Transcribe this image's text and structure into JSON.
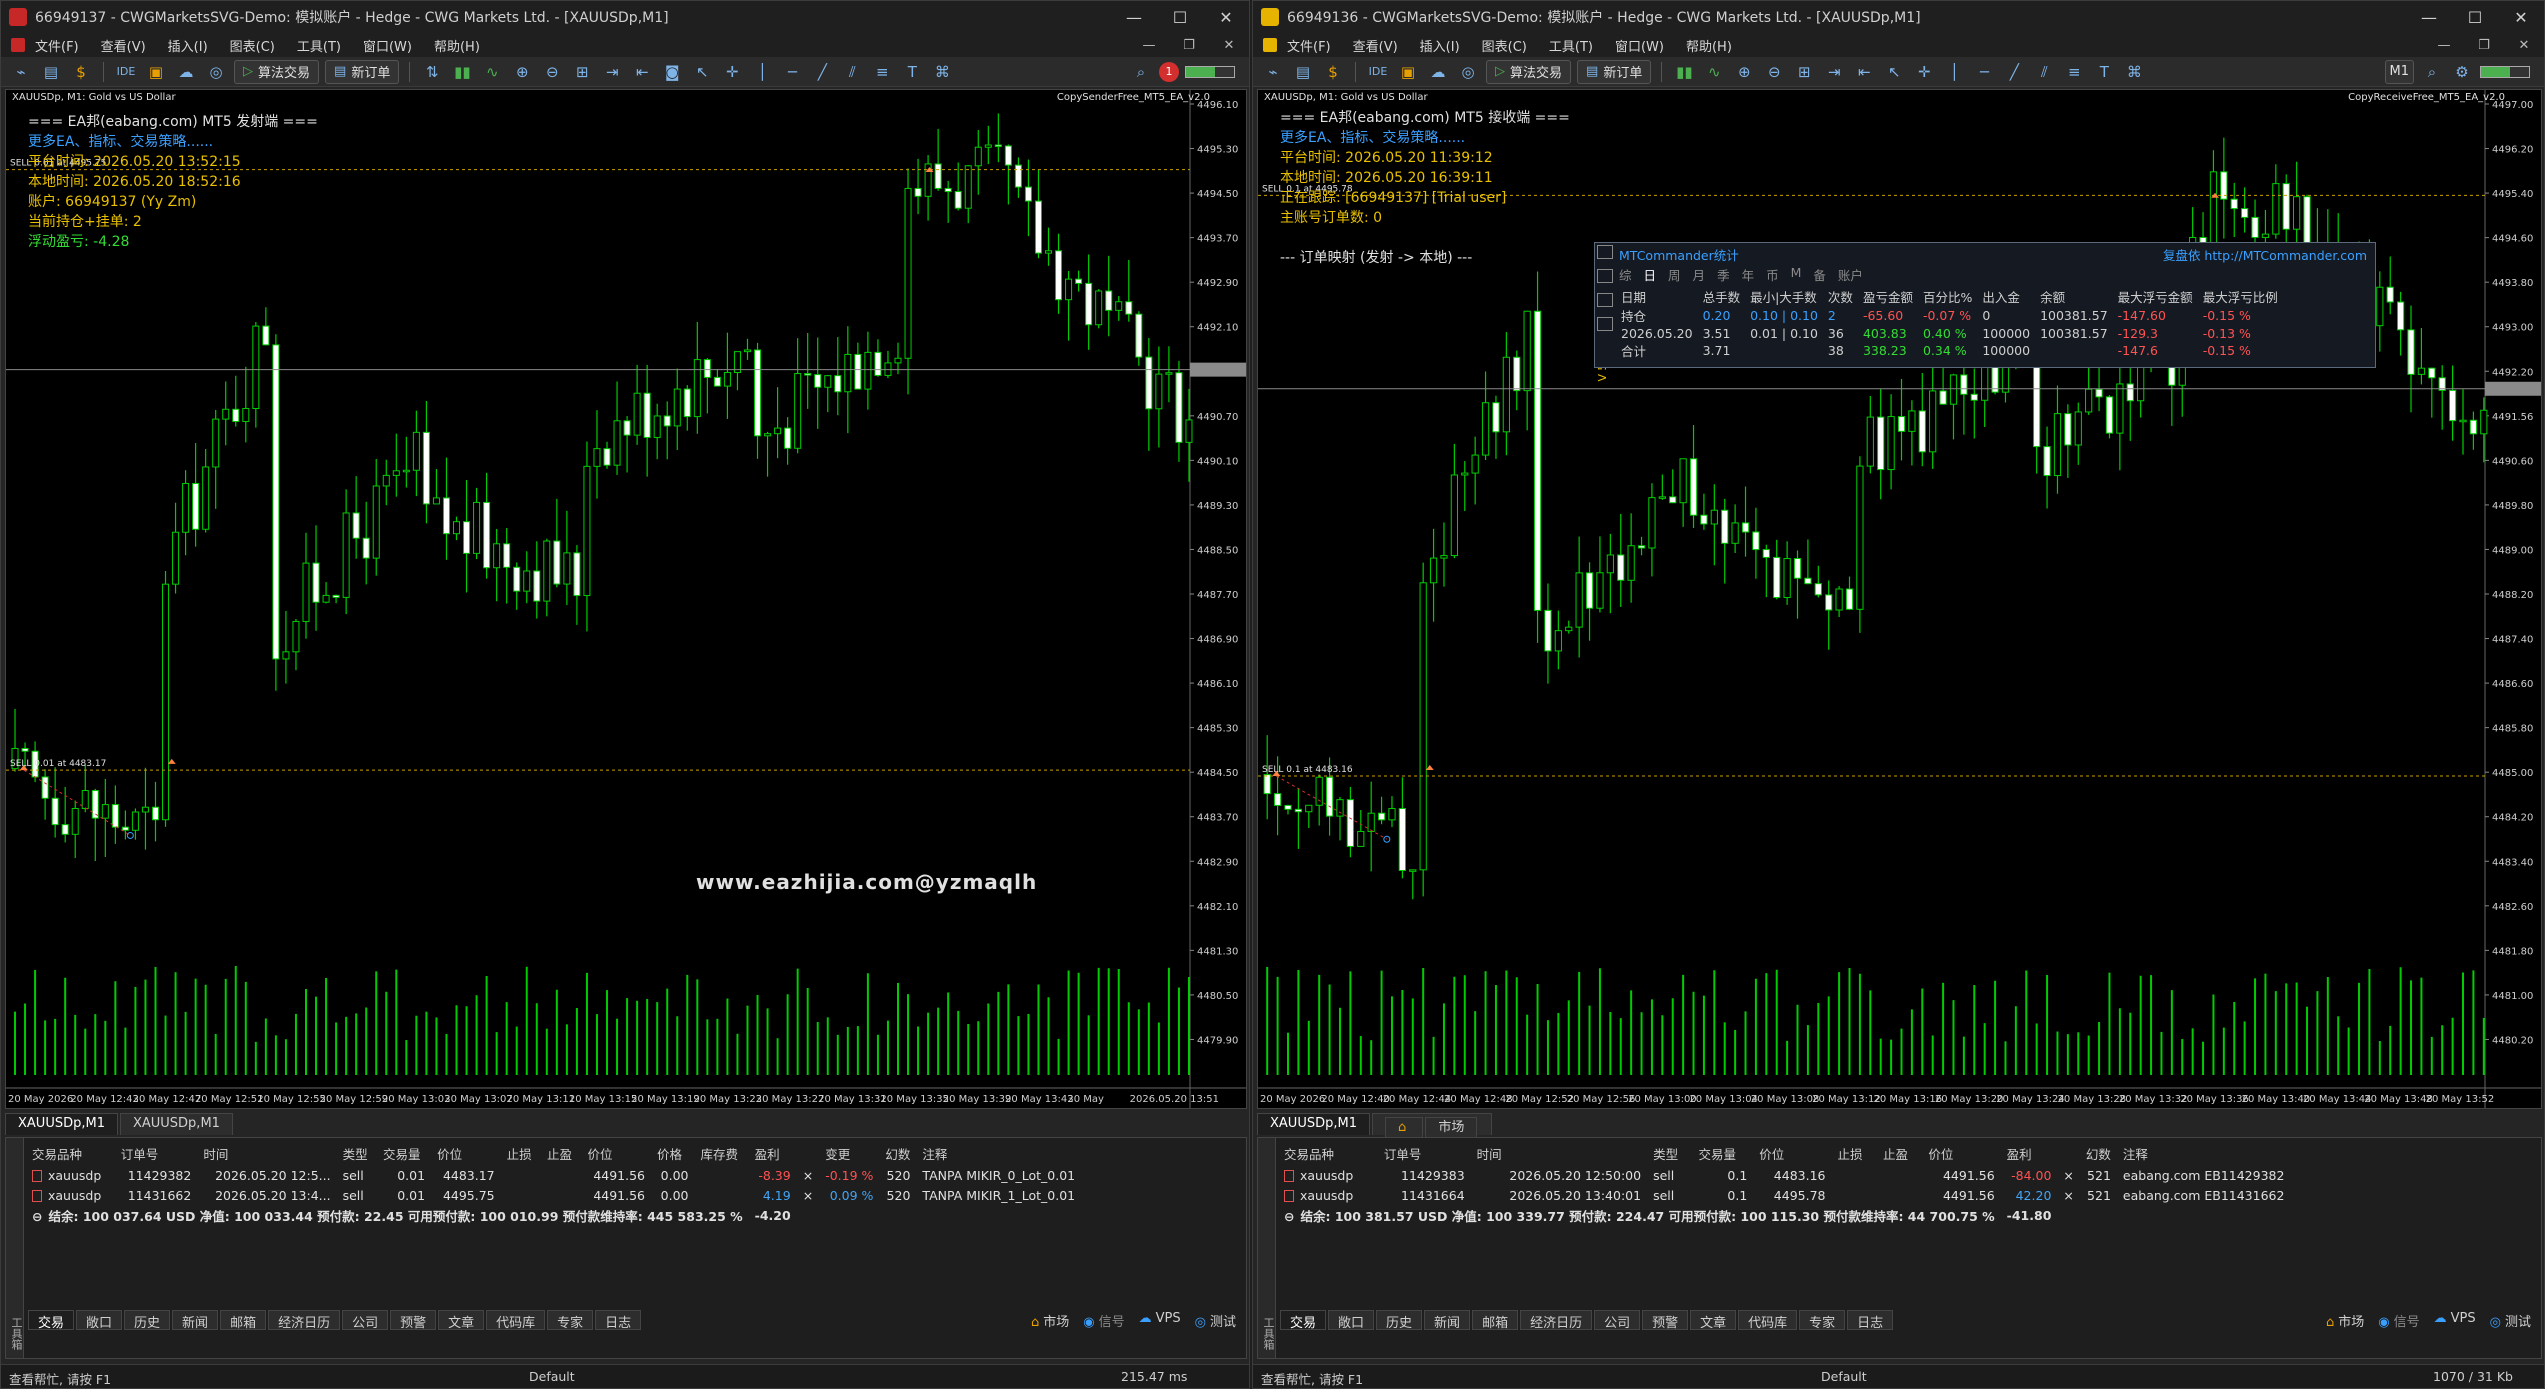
{
  "left": {
    "title": "66949137 - CWGMarketsSVG-Demo: 模拟账户 - Hedge - CWG Markets Ltd. - [XAUUSDp,M1]",
    "menu": [
      "文件(F)",
      "查看(V)",
      "插入(I)",
      "图表(C)",
      "工具(T)",
      "窗口(W)",
      "帮助(H)"
    ],
    "toolbar": {
      "algo": "算法交易",
      "new_order": "新订单",
      "ide": "IDE",
      "notif_count": "1"
    },
    "chart": {
      "symbol_desc": "XAUUSDp, M1:  Gold vs US Dollar",
      "ea_name": "CopySenderFree_MT5_EA_v2.0",
      "overlay": [
        {
          "text": "=== EA邦(eabang.com) MT5 发射端 ===",
          "cls": "w"
        },
        {
          "text": "更多EA、指标、交易策略......",
          "cls": "c"
        },
        {
          "text": "平台时间: 2026.05.20 13:52:15",
          "cls": "y"
        },
        {
          "text": "本地时间: 2026.05.20 18:52:16",
          "cls": "y"
        },
        {
          "text": "账户: 66949137 (Yy Zm)",
          "cls": "y"
        },
        {
          "text": "当前持仓+挂单: 2",
          "cls": "y"
        },
        {
          "text": "浮动盈亏: -4.28",
          "cls": "g"
        }
      ],
      "watermark": "www.eazhijia.com@yzmaqlh",
      "sell_label_top": "SELL 0.01 at 4495.75",
      "sell_label_bottom": "SELL 0.01 at 4483.17",
      "price_labels": [
        "4496.10",
        "4495.30",
        "4494.50",
        "4493.70",
        "4492.90",
        "4492.10",
        "4491.56",
        "4490.70",
        "4490.10",
        "4489.30",
        "4488.50",
        "4487.70",
        "4486.90",
        "4486.10",
        "4485.30",
        "4484.50",
        "4483.70",
        "4482.90",
        "4482.10",
        "4481.30",
        "4480.50",
        "4479.90"
      ],
      "time_labels": [
        "20 May 2026",
        "20 May 12:43",
        "20 May 12:47",
        "20 May 12:51",
        "20 May 12:55",
        "20 May 12:59",
        "20 May 13:03",
        "20 May 13:07",
        "20 May 13:11",
        "20 May 13:15",
        "20 May 13:19",
        "20 May 13:23",
        "20 May 13:27",
        "20 May 13:31",
        "20 May 13:35",
        "20 May 13:39",
        "20 May 13:43",
        "20 May",
        "2026.05.20 13:51"
      ]
    },
    "chart_tabs": [
      "XAUUSDp,M1",
      "XAUUSDp,M1"
    ],
    "table": {
      "headers": [
        "交易品种",
        "订单号",
        "时间",
        "类型",
        "交易量",
        "价位",
        "止损",
        "止盈",
        "价位",
        "价格",
        "库存费",
        "盈利",
        "",
        "变更",
        "幻数",
        "注释"
      ],
      "rows": [
        [
          "xauusdp",
          "11429382",
          "2026.05.20 12:5...",
          "sell",
          "0.01",
          "4483.17",
          "",
          "",
          "4491.56",
          "0.00",
          "",
          "-8.39",
          "×",
          "-0.19 %",
          "520",
          "TANPA MIKIR_0_Lot_0.01"
        ],
        [
          "xauusdp",
          "11431662",
          "2026.05.20 13:4...",
          "sell",
          "0.01",
          "4495.75",
          "",
          "",
          "4491.56",
          "0.00",
          "",
          "4.19",
          "×",
          "0.09 %",
          "520",
          "TANPA MIKIR_1_Lot_0.01"
        ]
      ],
      "summary": "结余: 100 037.64 USD  净值: 100 033.44  预付款: 22.45  可用预付款: 100 010.99  预付款维持率: 445 583.25 %",
      "summary_total": "-4.20"
    },
    "bottom_tabs": [
      "交易",
      "敞口",
      "历史",
      "新闻",
      "邮箱",
      "经济日历",
      "公司",
      "预警",
      "文章",
      "代码库",
      "专家",
      "日志"
    ],
    "bottom_right": [
      "市场",
      "信号",
      "VPS",
      "测试"
    ],
    "status": {
      "help": "查看帮忙, 请按 F1",
      "profile": "Default",
      "ping": "215.47 ms"
    }
  },
  "right": {
    "title": "66949136 - CWGMarketsSVG-Demo: 模拟账户 - Hedge - CWG Markets Ltd. - [XAUUSDp,M1]",
    "menu": [
      "文件(F)",
      "查看(V)",
      "插入(I)",
      "图表(C)",
      "工具(T)",
      "窗口(W)",
      "帮助(H)"
    ],
    "toolbar": {
      "algo": "算法交易",
      "new_order": "新订单",
      "ide": "IDE",
      "tf": "M1"
    },
    "chart": {
      "symbol_desc": "XAUUSDp, M1:  Gold vs US Dollar",
      "ea_name": "CopyReceiveFree_MT5_EA_v2.0",
      "overlay": [
        {
          "text": "=== EA邦(eabang.com) MT5 接收端 ===",
          "cls": "w"
        },
        {
          "text": "更多EA、指标、交易策略......",
          "cls": "c"
        },
        {
          "text": "平台时间: 2026.05.20 11:39:12",
          "cls": "y"
        },
        {
          "text": "本地时间: 2026.05.20 16:39:11",
          "cls": "y"
        },
        {
          "text": "正在跟踪: [66949137] [Trial user]",
          "cls": "y"
        },
        {
          "text": "主账号订单数: 0",
          "cls": "y"
        },
        {
          "text": "",
          "cls": "y"
        },
        {
          "text": "--- 订单映射 (发射 -> 本地) ---",
          "cls": "w"
        }
      ],
      "sell_label_top": "SELL 0.1 at 4495.78",
      "sell_label_bottom": "SELL 0.1 at 4483.16",
      "side_label": "V 5.15",
      "price_labels": [
        "4497.00",
        "4496.20",
        "4495.40",
        "4494.60",
        "4493.80",
        "4493.00",
        "4492.20",
        "4491.56",
        "4490.60",
        "4489.80",
        "4489.00",
        "4488.20",
        "4487.40",
        "4486.60",
        "4485.80",
        "4485.00",
        "4484.20",
        "4483.40",
        "4482.60",
        "4481.80",
        "4481.00",
        "4480.20"
      ],
      "time_labels": [
        "20 May 2026",
        "20 May 12:40",
        "20 May 12:44",
        "20 May 12:48",
        "20 May 12:52",
        "20 May 12:56",
        "20 May 13:00",
        "20 May 13:04",
        "20 May 13:08",
        "20 May 13:12",
        "20 May 13:16",
        "20 May 13:20",
        "20 May 13:24",
        "20 May 13:28",
        "20 May 13:32",
        "20 May 13:36",
        "20 May 13:40",
        "20 May 13:44",
        "20 May 13:48",
        "20 May 13:52"
      ],
      "mtc": {
        "title": "MTCommander统计",
        "link": "复盘依 http://MTCommander.com",
        "tabs": [
          "综",
          "日",
          "周",
          "月",
          "季",
          "年",
          "币",
          "M",
          "备",
          "账户"
        ],
        "headers": [
          "日期",
          "总手数",
          "最小|大手数",
          "次数",
          "盈亏金额",
          "百分比%",
          "出入金",
          "余额",
          "最大浮亏金额",
          "最大浮亏比例"
        ],
        "rows": [
          [
            "持仓",
            "0.20",
            "0.10 | 0.10",
            "2",
            "-65.60",
            "-0.07 %",
            "0",
            "100381.57",
            "-147.60",
            "-0.15 %"
          ],
          [
            "2026.05.20",
            "3.51",
            "0.01 | 0.10",
            "36",
            "403.83",
            "0.40 %",
            "100000",
            "100381.57",
            "-129.3",
            "-0.13 %"
          ],
          [
            "合计",
            "3.71",
            "",
            "38",
            "338.23",
            "0.34 %",
            "100000",
            "",
            "-147.6",
            "-0.15 %"
          ]
        ]
      }
    },
    "chart_tabs": [
      "XAUUSDp,M1",
      "市场"
    ],
    "table": {
      "headers": [
        "交易品种",
        "订单号",
        "时间",
        "类型",
        "交易量",
        "价位",
        "止损",
        "止盈",
        "价位",
        "盈利",
        "",
        "幻数",
        "注释"
      ],
      "rows": [
        [
          "xauusdp",
          "11429383",
          "2026.05.20 12:50:00",
          "sell",
          "0.1",
          "4483.16",
          "",
          "",
          "4491.56",
          "-84.00",
          "×",
          "521",
          "eabang.com EB11429382"
        ],
        [
          "xauusdp",
          "11431664",
          "2026.05.20 13:40:01",
          "sell",
          "0.1",
          "4495.78",
          "",
          "",
          "4491.56",
          "42.20",
          "×",
          "521",
          "eabang.com EB11431662"
        ]
      ],
      "summary": "结余: 100 381.57 USD  净值: 100 339.77  预付款: 224.47  可用预付款: 100 115.30  预付款维持率: 44 700.75 %",
      "summary_total": "-41.80"
    },
    "bottom_tabs": [
      "交易",
      "敞口",
      "历史",
      "新闻",
      "邮箱",
      "经济日历",
      "公司",
      "预警",
      "文章",
      "代码库",
      "专家",
      "日志"
    ],
    "bottom_right": [
      "市场",
      "信号",
      "VPS",
      "测试"
    ],
    "status": {
      "help": "查看帮忙, 请按 F1",
      "profile": "Default",
      "ping": "1070 / 31 Kb"
    }
  },
  "colors": {
    "bull": "#ffffff",
    "bear": "#ffffff",
    "wick": "#00cc00",
    "grid": "#1a1a1a",
    "sell_line": "#c8a000",
    "volume": "#00cc00"
  }
}
